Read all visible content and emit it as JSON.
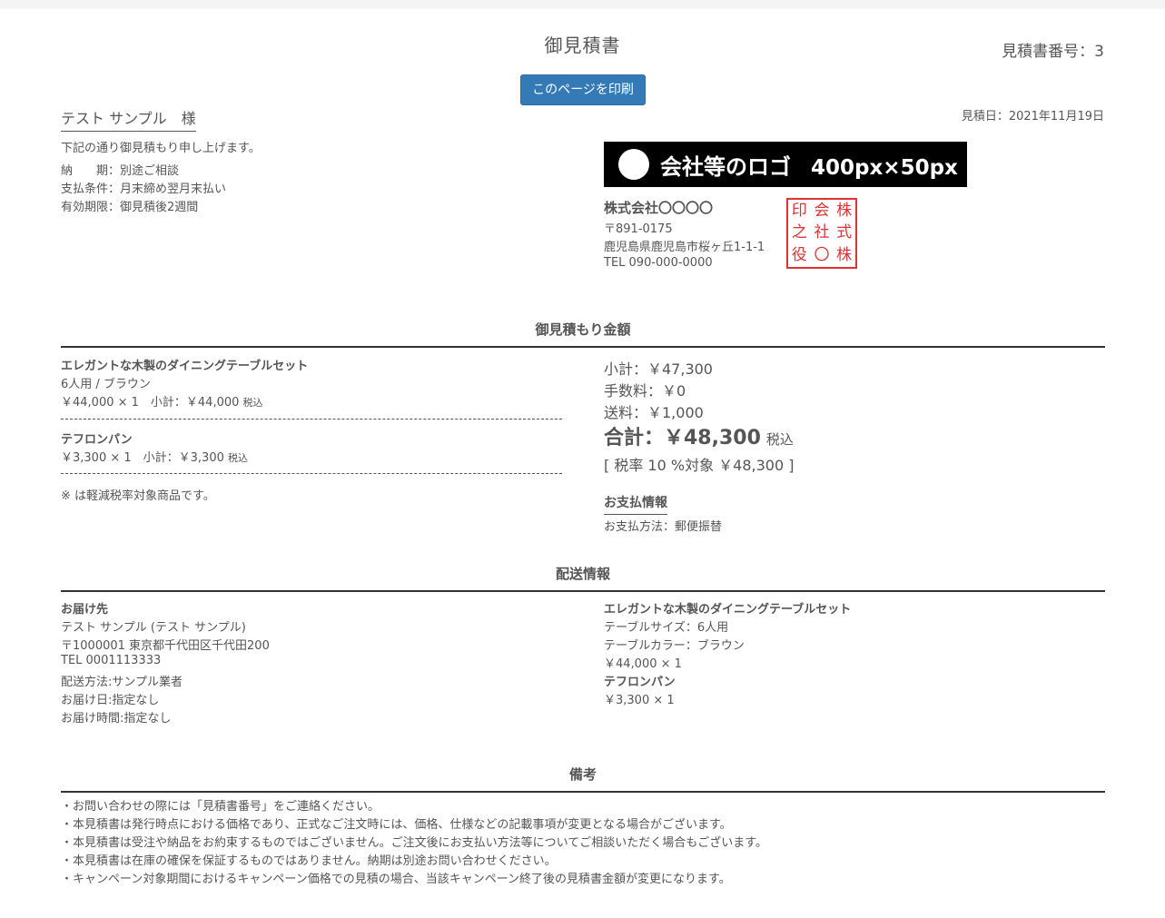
{
  "document": {
    "title": "御見積書",
    "quote_number": "見積書番号：3",
    "print_button": "このページを印刷",
    "recipient": "テスト サンプル　様",
    "quote_date": "見積日：2021年11月19日",
    "intro": "下記の通り御見積もり申し上げます。",
    "terms": [
      "納　　期：別途ご相談",
      "支払条件：月末締め翌月末払い",
      "有効期限：御見積後2週間"
    ]
  },
  "company": {
    "logo_text": "会社等のロゴ",
    "logo_size_text": "400px×50px",
    "name": "株式会社〇〇〇〇",
    "postal": "〒891-0175",
    "address": "鹿児島県鹿児島市桜ヶ丘1-1-1",
    "tel": "TEL 090-000-0000",
    "seal_chars": [
      "印",
      "会",
      "株",
      "之",
      "社",
      "式",
      "役",
      "〇",
      "株"
    ]
  },
  "estimate": {
    "heading": "御見積もり金額",
    "items": [
      {
        "name": "エレガントな木製のダイニングテーブルセット",
        "option": "6人用 / ブラウン",
        "price_line": "￥44,000 × 1　小計：￥44,000",
        "tax_label": "税込"
      },
      {
        "name": "テフロンパン",
        "price_line": "￥3,300 × 1　小計：￥3,300",
        "tax_label": "税込"
      }
    ],
    "note": "※ は軽減税率対象商品です。",
    "subtotal": "小計：￥47,300",
    "fee": "手数料：￥0",
    "shipping": "送料：￥1,000",
    "total": "合計：￥48,300",
    "total_tax_label": "税込",
    "tax_breakdown": "[ 税率 10 %対象 ￥48,300 ]",
    "payment_heading": "お支払情報",
    "payment_method": "お支払方法：郵便振替"
  },
  "delivery": {
    "heading": "配送情報",
    "recipient_heading": "お届け先",
    "recipient_lines": [
      "テスト サンプル (テスト サンプル)",
      "〒1000001 東京都千代田区千代田200",
      "TEL 0001113333",
      "配送方法:サンプル業者",
      "お届け日:指定なし",
      "お届け時間:指定なし"
    ],
    "item1_name": "エレガントな木製のダイニングテーブルセット",
    "item1_lines": [
      "テーブルサイズ：6人用",
      "テーブルカラー：ブラウン",
      "￥44,000 × 1"
    ],
    "item2_name": "テフロンパン",
    "item2_line": "￥3,300 × 1"
  },
  "remarks": {
    "heading": "備考",
    "lines": [
      "・お問い合わせの際には「見積書番号」をご連絡ください。",
      "・本見積書は発行時点における価格であり、正式なご注文時には、価格、仕様などの記載事項が変更となる場合がございます。",
      "・本見積書は受注や納品をお約束するものではございません。ご注文後にお支払い方法等についてご相談いただく場合もございます。",
      "・本見積書は在庫の確保を保証するものではありません。納期は別途お問い合わせください。",
      "・キャンペーン対象期間におけるキャンペーン価格での見積の場合、当該キャンペーン終了後の見積書金額が変更になります。"
    ]
  }
}
